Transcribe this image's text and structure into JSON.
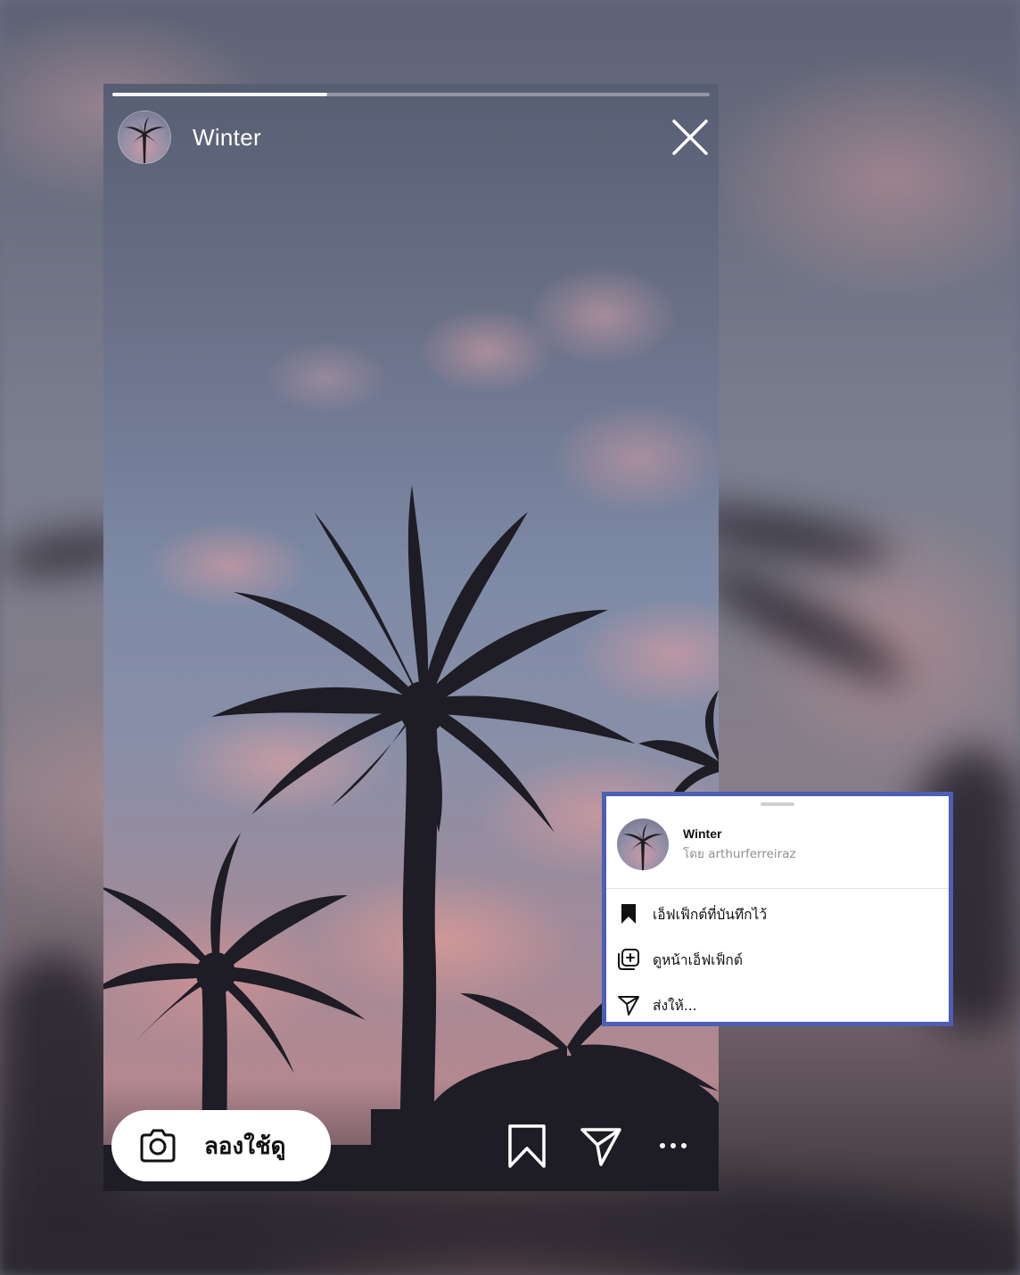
{
  "story": {
    "title": "Winter",
    "progress": 0.36,
    "try_label": "ลองใช้ดู"
  },
  "sheet": {
    "effect_name": "Winter",
    "creator": "โดย arthurferreiraz",
    "menu": [
      {
        "icon": "bookmark-filled-icon",
        "label": "เอ็ฟเฟ็กต์ที่บันทึกไว้"
      },
      {
        "icon": "effect-page-icon",
        "label": "ดูหน้าเอ็ฟเฟ็กต์"
      },
      {
        "icon": "send-icon",
        "label": "ส่งให้..."
      }
    ]
  },
  "colors": {
    "sheet_border": "#4d5eb6",
    "sheet_bg": "#ffffff",
    "secondary_text": "#8e8e8e"
  }
}
